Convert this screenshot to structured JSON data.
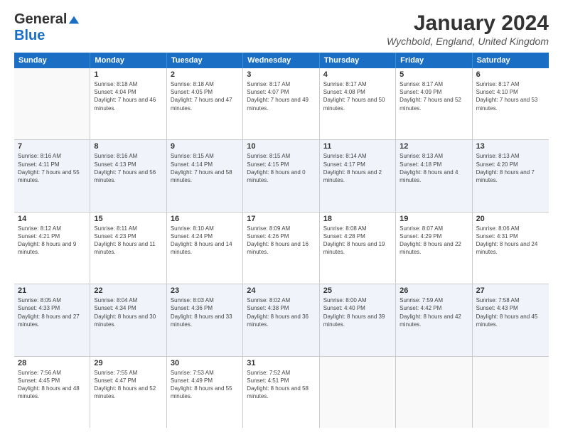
{
  "logo": {
    "general": "General",
    "blue": "Blue"
  },
  "title": "January 2024",
  "location": "Wychbold, England, United Kingdom",
  "days_of_week": [
    "Sunday",
    "Monday",
    "Tuesday",
    "Wednesday",
    "Thursday",
    "Friday",
    "Saturday"
  ],
  "weeks": [
    [
      {
        "day": "",
        "sunrise": "",
        "sunset": "",
        "daylight": ""
      },
      {
        "day": "1",
        "sunrise": "Sunrise: 8:18 AM",
        "sunset": "Sunset: 4:04 PM",
        "daylight": "Daylight: 7 hours and 46 minutes."
      },
      {
        "day": "2",
        "sunrise": "Sunrise: 8:18 AM",
        "sunset": "Sunset: 4:05 PM",
        "daylight": "Daylight: 7 hours and 47 minutes."
      },
      {
        "day": "3",
        "sunrise": "Sunrise: 8:17 AM",
        "sunset": "Sunset: 4:07 PM",
        "daylight": "Daylight: 7 hours and 49 minutes."
      },
      {
        "day": "4",
        "sunrise": "Sunrise: 8:17 AM",
        "sunset": "Sunset: 4:08 PM",
        "daylight": "Daylight: 7 hours and 50 minutes."
      },
      {
        "day": "5",
        "sunrise": "Sunrise: 8:17 AM",
        "sunset": "Sunset: 4:09 PM",
        "daylight": "Daylight: 7 hours and 52 minutes."
      },
      {
        "day": "6",
        "sunrise": "Sunrise: 8:17 AM",
        "sunset": "Sunset: 4:10 PM",
        "daylight": "Daylight: 7 hours and 53 minutes."
      }
    ],
    [
      {
        "day": "7",
        "sunrise": "Sunrise: 8:16 AM",
        "sunset": "Sunset: 4:11 PM",
        "daylight": "Daylight: 7 hours and 55 minutes."
      },
      {
        "day": "8",
        "sunrise": "Sunrise: 8:16 AM",
        "sunset": "Sunset: 4:13 PM",
        "daylight": "Daylight: 7 hours and 56 minutes."
      },
      {
        "day": "9",
        "sunrise": "Sunrise: 8:15 AM",
        "sunset": "Sunset: 4:14 PM",
        "daylight": "Daylight: 7 hours and 58 minutes."
      },
      {
        "day": "10",
        "sunrise": "Sunrise: 8:15 AM",
        "sunset": "Sunset: 4:15 PM",
        "daylight": "Daylight: 8 hours and 0 minutes."
      },
      {
        "day": "11",
        "sunrise": "Sunrise: 8:14 AM",
        "sunset": "Sunset: 4:17 PM",
        "daylight": "Daylight: 8 hours and 2 minutes."
      },
      {
        "day": "12",
        "sunrise": "Sunrise: 8:13 AM",
        "sunset": "Sunset: 4:18 PM",
        "daylight": "Daylight: 8 hours and 4 minutes."
      },
      {
        "day": "13",
        "sunrise": "Sunrise: 8:13 AM",
        "sunset": "Sunset: 4:20 PM",
        "daylight": "Daylight: 8 hours and 7 minutes."
      }
    ],
    [
      {
        "day": "14",
        "sunrise": "Sunrise: 8:12 AM",
        "sunset": "Sunset: 4:21 PM",
        "daylight": "Daylight: 8 hours and 9 minutes."
      },
      {
        "day": "15",
        "sunrise": "Sunrise: 8:11 AM",
        "sunset": "Sunset: 4:23 PM",
        "daylight": "Daylight: 8 hours and 11 minutes."
      },
      {
        "day": "16",
        "sunrise": "Sunrise: 8:10 AM",
        "sunset": "Sunset: 4:24 PM",
        "daylight": "Daylight: 8 hours and 14 minutes."
      },
      {
        "day": "17",
        "sunrise": "Sunrise: 8:09 AM",
        "sunset": "Sunset: 4:26 PM",
        "daylight": "Daylight: 8 hours and 16 minutes."
      },
      {
        "day": "18",
        "sunrise": "Sunrise: 8:08 AM",
        "sunset": "Sunset: 4:28 PM",
        "daylight": "Daylight: 8 hours and 19 minutes."
      },
      {
        "day": "19",
        "sunrise": "Sunrise: 8:07 AM",
        "sunset": "Sunset: 4:29 PM",
        "daylight": "Daylight: 8 hours and 22 minutes."
      },
      {
        "day": "20",
        "sunrise": "Sunrise: 8:06 AM",
        "sunset": "Sunset: 4:31 PM",
        "daylight": "Daylight: 8 hours and 24 minutes."
      }
    ],
    [
      {
        "day": "21",
        "sunrise": "Sunrise: 8:05 AM",
        "sunset": "Sunset: 4:33 PM",
        "daylight": "Daylight: 8 hours and 27 minutes."
      },
      {
        "day": "22",
        "sunrise": "Sunrise: 8:04 AM",
        "sunset": "Sunset: 4:34 PM",
        "daylight": "Daylight: 8 hours and 30 minutes."
      },
      {
        "day": "23",
        "sunrise": "Sunrise: 8:03 AM",
        "sunset": "Sunset: 4:36 PM",
        "daylight": "Daylight: 8 hours and 33 minutes."
      },
      {
        "day": "24",
        "sunrise": "Sunrise: 8:02 AM",
        "sunset": "Sunset: 4:38 PM",
        "daylight": "Daylight: 8 hours and 36 minutes."
      },
      {
        "day": "25",
        "sunrise": "Sunrise: 8:00 AM",
        "sunset": "Sunset: 4:40 PM",
        "daylight": "Daylight: 8 hours and 39 minutes."
      },
      {
        "day": "26",
        "sunrise": "Sunrise: 7:59 AM",
        "sunset": "Sunset: 4:42 PM",
        "daylight": "Daylight: 8 hours and 42 minutes."
      },
      {
        "day": "27",
        "sunrise": "Sunrise: 7:58 AM",
        "sunset": "Sunset: 4:43 PM",
        "daylight": "Daylight: 8 hours and 45 minutes."
      }
    ],
    [
      {
        "day": "28",
        "sunrise": "Sunrise: 7:56 AM",
        "sunset": "Sunset: 4:45 PM",
        "daylight": "Daylight: 8 hours and 48 minutes."
      },
      {
        "day": "29",
        "sunrise": "Sunrise: 7:55 AM",
        "sunset": "Sunset: 4:47 PM",
        "daylight": "Daylight: 8 hours and 52 minutes."
      },
      {
        "day": "30",
        "sunrise": "Sunrise: 7:53 AM",
        "sunset": "Sunset: 4:49 PM",
        "daylight": "Daylight: 8 hours and 55 minutes."
      },
      {
        "day": "31",
        "sunrise": "Sunrise: 7:52 AM",
        "sunset": "Sunset: 4:51 PM",
        "daylight": "Daylight: 8 hours and 58 minutes."
      },
      {
        "day": "",
        "sunrise": "",
        "sunset": "",
        "daylight": ""
      },
      {
        "day": "",
        "sunrise": "",
        "sunset": "",
        "daylight": ""
      },
      {
        "day": "",
        "sunrise": "",
        "sunset": "",
        "daylight": ""
      }
    ]
  ]
}
